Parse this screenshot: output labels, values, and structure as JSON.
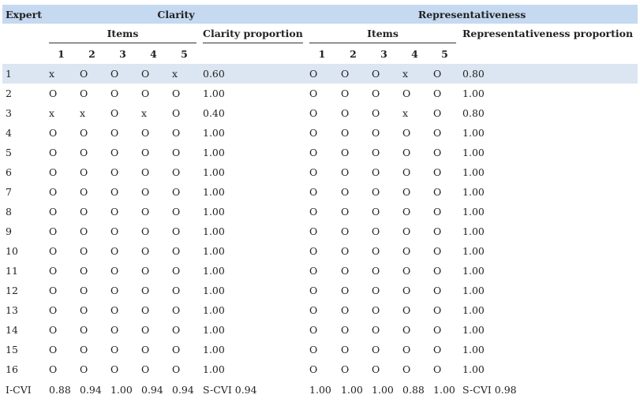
{
  "header": {
    "expert_label": "Expert",
    "clarity_label": "Clarity",
    "representativeness_label": "Representativeness",
    "items_label": "Items",
    "clarity_proportion_label": "Clarity proportion",
    "representativeness_proportion_label": "Representativeness proportion",
    "item_numbers": [
      "1",
      "2",
      "3",
      "4",
      "5"
    ]
  },
  "rows": [
    {
      "expert": "1",
      "clarity": [
        "x",
        "O",
        "O",
        "O",
        "x"
      ],
      "clarity_prop": "0.60",
      "rep": [
        "O",
        "O",
        "O",
        "x",
        "O"
      ],
      "rep_prop": "0.80"
    },
    {
      "expert": "2",
      "clarity": [
        "O",
        "O",
        "O",
        "O",
        "O"
      ],
      "clarity_prop": "1.00",
      "rep": [
        "O",
        "O",
        "O",
        "O",
        "O"
      ],
      "rep_prop": "1.00"
    },
    {
      "expert": "3",
      "clarity": [
        "x",
        "x",
        "O",
        "x",
        "O"
      ],
      "clarity_prop": "0.40",
      "rep": [
        "O",
        "O",
        "O",
        "x",
        "O"
      ],
      "rep_prop": "0.80"
    },
    {
      "expert": "4",
      "clarity": [
        "O",
        "O",
        "O",
        "O",
        "O"
      ],
      "clarity_prop": "1.00",
      "rep": [
        "O",
        "O",
        "O",
        "O",
        "O"
      ],
      "rep_prop": "1.00"
    },
    {
      "expert": "5",
      "clarity": [
        "O",
        "O",
        "O",
        "O",
        "O"
      ],
      "clarity_prop": "1.00",
      "rep": [
        "O",
        "O",
        "O",
        "O",
        "O"
      ],
      "rep_prop": "1.00"
    },
    {
      "expert": "6",
      "clarity": [
        "O",
        "O",
        "O",
        "O",
        "O"
      ],
      "clarity_prop": "1.00",
      "rep": [
        "O",
        "O",
        "O",
        "O",
        "O"
      ],
      "rep_prop": "1.00"
    },
    {
      "expert": "7",
      "clarity": [
        "O",
        "O",
        "O",
        "O",
        "O"
      ],
      "clarity_prop": "1.00",
      "rep": [
        "O",
        "O",
        "O",
        "O",
        "O"
      ],
      "rep_prop": "1.00"
    },
    {
      "expert": "8",
      "clarity": [
        "O",
        "O",
        "O",
        "O",
        "O"
      ],
      "clarity_prop": "1.00",
      "rep": [
        "O",
        "O",
        "O",
        "O",
        "O"
      ],
      "rep_prop": "1.00"
    },
    {
      "expert": "9",
      "clarity": [
        "O",
        "O",
        "O",
        "O",
        "O"
      ],
      "clarity_prop": "1.00",
      "rep": [
        "O",
        "O",
        "O",
        "O",
        "O"
      ],
      "rep_prop": "1.00"
    },
    {
      "expert": "10",
      "clarity": [
        "O",
        "O",
        "O",
        "O",
        "O"
      ],
      "clarity_prop": "1.00",
      "rep": [
        "O",
        "O",
        "O",
        "O",
        "O"
      ],
      "rep_prop": "1.00"
    },
    {
      "expert": "11",
      "clarity": [
        "O",
        "O",
        "O",
        "O",
        "O"
      ],
      "clarity_prop": "1.00",
      "rep": [
        "O",
        "O",
        "O",
        "O",
        "O"
      ],
      "rep_prop": "1.00"
    },
    {
      "expert": "12",
      "clarity": [
        "O",
        "O",
        "O",
        "O",
        "O"
      ],
      "clarity_prop": "1.00",
      "rep": [
        "O",
        "O",
        "O",
        "O",
        "O"
      ],
      "rep_prop": "1.00"
    },
    {
      "expert": "13",
      "clarity": [
        "O",
        "O",
        "O",
        "O",
        "O"
      ],
      "clarity_prop": "1.00",
      "rep": [
        "O",
        "O",
        "O",
        "O",
        "O"
      ],
      "rep_prop": "1.00"
    },
    {
      "expert": "14",
      "clarity": [
        "O",
        "O",
        "O",
        "O",
        "O"
      ],
      "clarity_prop": "1.00",
      "rep": [
        "O",
        "O",
        "O",
        "O",
        "O"
      ],
      "rep_prop": "1.00"
    },
    {
      "expert": "15",
      "clarity": [
        "O",
        "O",
        "O",
        "O",
        "O"
      ],
      "clarity_prop": "1.00",
      "rep": [
        "O",
        "O",
        "O",
        "O",
        "O"
      ],
      "rep_prop": "1.00"
    },
    {
      "expert": "16",
      "clarity": [
        "O",
        "O",
        "O",
        "O",
        "O"
      ],
      "clarity_prop": "1.00",
      "rep": [
        "O",
        "O",
        "O",
        "O",
        "O"
      ],
      "rep_prop": "1.00"
    }
  ],
  "summary": {
    "label": "I-CVI",
    "clarity": [
      "0.88",
      "0.94",
      "1.00",
      "0.94",
      "0.94"
    ],
    "clarity_scvi": "S-CVI 0.94",
    "rep": [
      "1.00",
      "1.00",
      "1.00",
      "0.88",
      "1.00"
    ],
    "rep_scvi": "S-CVI 0.98"
  },
  "highlight_row_index": 0,
  "colors": {
    "header_bg": "#c5d9f1",
    "highlight_bg": "#dce6f2"
  }
}
